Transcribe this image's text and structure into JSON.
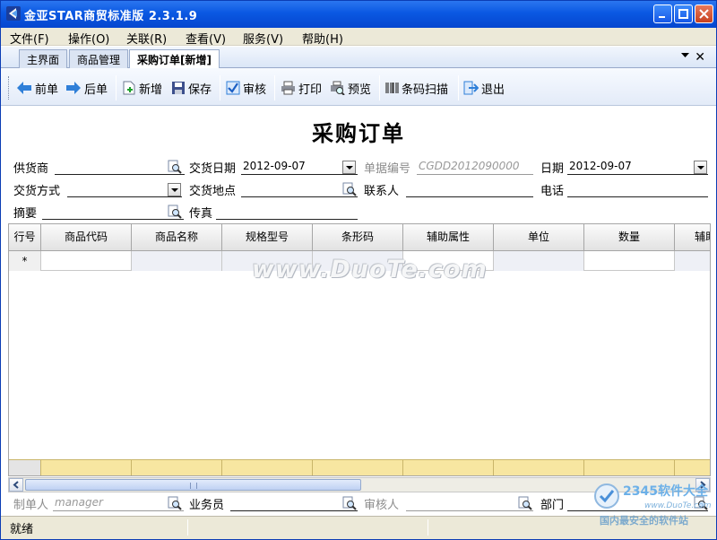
{
  "window": {
    "title": "金亚STAR商贸标准版 2.3.1.9"
  },
  "menu": [
    {
      "label": "文件(F)"
    },
    {
      "label": "操作(O)"
    },
    {
      "label": "关联(R)"
    },
    {
      "label": "查看(V)"
    },
    {
      "label": "服务(V)"
    },
    {
      "label": "帮助(H)"
    }
  ],
  "tabs": [
    {
      "label": "主界面",
      "active": false
    },
    {
      "label": "商品管理",
      "active": false
    },
    {
      "label": "采购订单[新增]",
      "active": true
    }
  ],
  "toolbar": {
    "prev": "前单",
    "next": "后单",
    "add": "新增",
    "save": "保存",
    "audit": "审核",
    "print": "打印",
    "preview": "预览",
    "scan": "条码扫描",
    "exit": "退出"
  },
  "form": {
    "title": "采购订单",
    "supplier_label": "供货商",
    "supplier_value": "",
    "delivery_date_label": "交货日期",
    "delivery_date_value": "2012-09-07",
    "doc_no_label": "单据编号",
    "doc_no_value": "CGDD2012090000",
    "date_label": "日期",
    "date_value": "2012-09-07",
    "delivery_method_label": "交货方式",
    "delivery_method_value": "",
    "delivery_place_label": "交货地点",
    "delivery_place_value": "",
    "contact_label": "联系人",
    "contact_value": "",
    "phone_label": "电话",
    "phone_value": "",
    "summary_label": "摘要",
    "summary_value": "",
    "fax_label": "传真",
    "fax_value": ""
  },
  "grid": {
    "columns": [
      "行号",
      "商品代码",
      "商品名称",
      "规格型号",
      "条形码",
      "辅助属性",
      "单位",
      "数量",
      "辅助"
    ],
    "new_row_marker": "*"
  },
  "footer_form": {
    "creator_label": "制单人",
    "creator_value": "manager",
    "salesman_label": "业务员",
    "salesman_value": "",
    "auditor_label": "审核人",
    "auditor_value": "",
    "dept_label": "部门",
    "dept_value": ""
  },
  "status": {
    "text": "就绪"
  },
  "watermark": {
    "text": "www.DuoTe.com",
    "corner_brand": "2345软件大全",
    "corner_url": "www.DuoTe.com",
    "corner_slogan": "国内最安全的软件站"
  },
  "colors": {
    "titlebar": "#0a58e2",
    "grid_footer": "#f7e6a1",
    "toolbar_icon_blue": "#2f7fd8"
  }
}
